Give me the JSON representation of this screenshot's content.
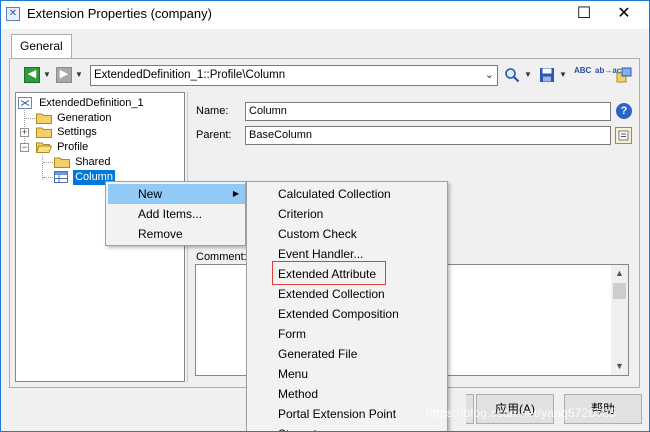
{
  "window": {
    "title": "Extension Properties (company)",
    "minimize_glyph": "—",
    "maximize_glyph": "☐",
    "close_glyph": "✕"
  },
  "tabs": [
    {
      "label": "General"
    }
  ],
  "toolbar": {
    "path": "ExtendedDefinition_1::Profile\\Column",
    "spell_text": "ABC",
    "replace_text": "ab→ac"
  },
  "tree": {
    "root": "ExtendedDefinition_1",
    "nodes": [
      {
        "label": "Generation"
      },
      {
        "label": "Settings"
      },
      {
        "label": "Profile"
      },
      {
        "label": "Shared"
      },
      {
        "label": "Column"
      }
    ]
  },
  "details": {
    "name_label": "Name:",
    "name_value": "Column",
    "parent_label": "Parent:",
    "parent_value": "BaseColumn",
    "comment_label": "Comment:"
  },
  "buttons": {
    "apply": "应用(A)",
    "help": "帮助"
  },
  "context_menu": {
    "items": [
      {
        "label": "New",
        "has_submenu": true
      },
      {
        "label": "Add Items..."
      },
      {
        "label": "Remove"
      }
    ]
  },
  "submenu": {
    "items": [
      {
        "label": "Calculated Collection"
      },
      {
        "label": "Criterion"
      },
      {
        "label": "Custom Check"
      },
      {
        "label": "Event Handler..."
      },
      {
        "label": "Extended Attribute"
      },
      {
        "label": "Extended Collection"
      },
      {
        "label": "Extended Composition"
      },
      {
        "label": "Form"
      },
      {
        "label": "Generated File"
      },
      {
        "label": "Menu"
      },
      {
        "label": "Method"
      },
      {
        "label": "Portal Extension Point"
      },
      {
        "label": "Stereotype"
      }
    ],
    "highlighted": "Extended Attribute"
  },
  "watermark": "https://blog.csdn.net/yang5726685",
  "colors": {
    "accent": "#0078d7",
    "menu_highlight": "#91c9f7",
    "outline_red": "#e03c3c",
    "folder_yellow": "#f4d06a"
  }
}
